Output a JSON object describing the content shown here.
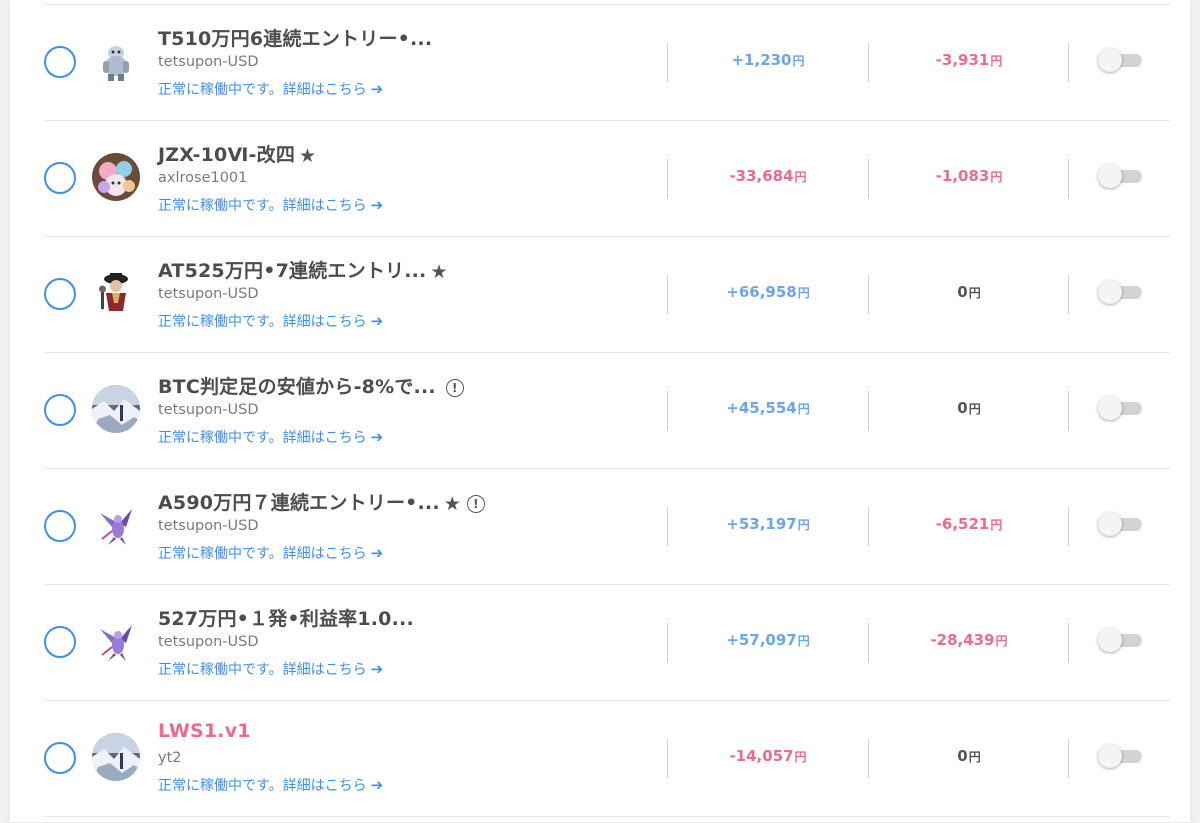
{
  "status_text": "正常に稼働中です。詳細はこちら",
  "unit": "円",
  "rows": [
    {
      "title": "T510万円6連続エントリー•...",
      "title_color": "#4d4d4d",
      "star": "",
      "info": "",
      "account": "tetsupon-USD",
      "value1": "+1,230",
      "value1_sign": "pos",
      "value2": "-3,931",
      "value2_sign": "neg",
      "avatar": "yeti-robot",
      "toggle": "off"
    },
    {
      "title": "JZX-10Ⅵ-改四",
      "title_color": "#4d4d4d",
      "star": "★",
      "info": "",
      "account": "axlrose1001",
      "value1": "-33,684",
      "value1_sign": "neg",
      "value2": "-1,083",
      "value2_sign": "neg",
      "avatar": "plush-toys",
      "toggle": "off"
    },
    {
      "title": "AT525万円•7連続エントリ...",
      "title_color": "#4d4d4d",
      "star": "★",
      "info": "",
      "account": "tetsupon-USD",
      "value1": "+66,958",
      "value1_sign": "pos",
      "value2": "0",
      "value2_sign": "zero",
      "avatar": "pirate-character",
      "toggle": "off"
    },
    {
      "title": "BTC判定足の安値から-8%で...",
      "title_color": "#4d4d4d",
      "star": "",
      "info": "!",
      "account": "tetsupon-USD",
      "value1": "+45,554",
      "value1_sign": "pos",
      "value2": "0",
      "value2_sign": "zero",
      "avatar": "snow-landscape",
      "toggle": "off"
    },
    {
      "title": "A590万円７連続エントリー•...",
      "title_color": "#4d4d4d",
      "star": "★",
      "info": "!",
      "account": "tetsupon-USD",
      "value1": "+53,197",
      "value1_sign": "pos",
      "value2": "-6,521",
      "value2_sign": "neg",
      "avatar": "purple-dragon",
      "toggle": "off"
    },
    {
      "title": "527万円•１発•利益率1.0...",
      "title_color": "#4d4d4d",
      "star": "",
      "info": "",
      "account": "tetsupon-USD",
      "value1": "+57,097",
      "value1_sign": "pos",
      "value2": "-28,439",
      "value2_sign": "neg",
      "avatar": "purple-dragon",
      "toggle": "off"
    },
    {
      "title": "LWS1.v1",
      "title_color": "#ec6a8c",
      "star": "",
      "info": "",
      "account": "yt2",
      "value1": "-14,057",
      "value1_sign": "neg",
      "value2": "0",
      "value2_sign": "zero",
      "avatar": "snow-landscape",
      "toggle": "off"
    }
  ]
}
